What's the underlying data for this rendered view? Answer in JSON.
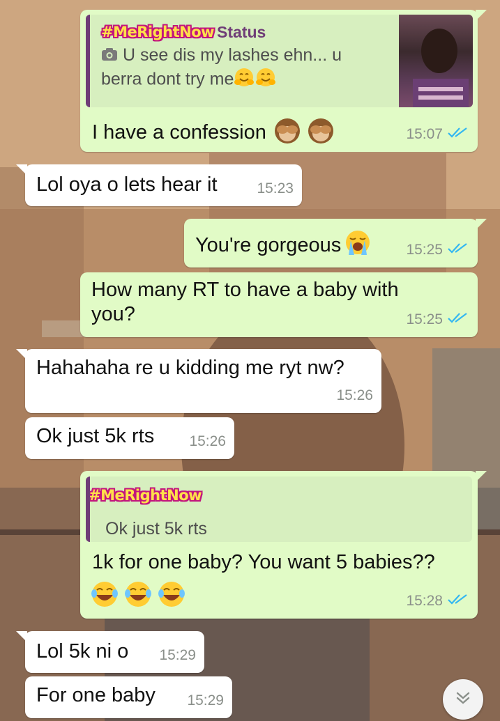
{
  "colors": {
    "outgoing_bubble": "#e1fbc6",
    "incoming_bubble": "#ffffff",
    "quote_accent": "#6f3d77",
    "read_ticks": "#34b7f1",
    "sticker_text": "#ffe14a",
    "sticker_outline": "#c2157e"
  },
  "messages": [
    {
      "direction": "outgoing",
      "reply": {
        "sticker": "#MeRightNow",
        "source": "Status",
        "icon": "camera-icon",
        "text_line1": "U see dis my lashes ehn... u",
        "text_line2": "berra dont try me",
        "emoji": "hugging-face-emoji",
        "thumbnail": "status-photo-thumbnail"
      },
      "text": "I have a confession",
      "emoji": "see-no-evil-monkey-emoji",
      "time": "15:07",
      "status": "read"
    },
    {
      "direction": "incoming",
      "text": "Lol oya o lets hear it",
      "time": "15:23"
    },
    {
      "direction": "outgoing",
      "text": "You're gorgeous",
      "emoji": "loudly-crying-face-emoji",
      "time": "15:25",
      "status": "read"
    },
    {
      "direction": "outgoing",
      "text_line1": "How many RT to have a baby with",
      "text_line2": "you?",
      "time": "15:25",
      "status": "read"
    },
    {
      "direction": "incoming",
      "text": "Hahahaha re u kidding me ryt nw?",
      "time": "15:26"
    },
    {
      "direction": "incoming",
      "text": "Ok just 5k rts",
      "time": "15:26"
    },
    {
      "direction": "outgoing",
      "reply": {
        "sticker": "#MeRightNow",
        "text": "Ok just 5k rts"
      },
      "text": "1k for one baby? You want 5 babies??",
      "emoji": "face-with-tears-of-joy-emoji",
      "time": "15:28",
      "status": "read"
    },
    {
      "direction": "incoming",
      "text": "Lol 5k ni o",
      "time": "15:29"
    },
    {
      "direction": "incoming",
      "text": "For one baby",
      "time": "15:29"
    }
  ],
  "scroll_down_icon": "double-chevron-down-icon"
}
